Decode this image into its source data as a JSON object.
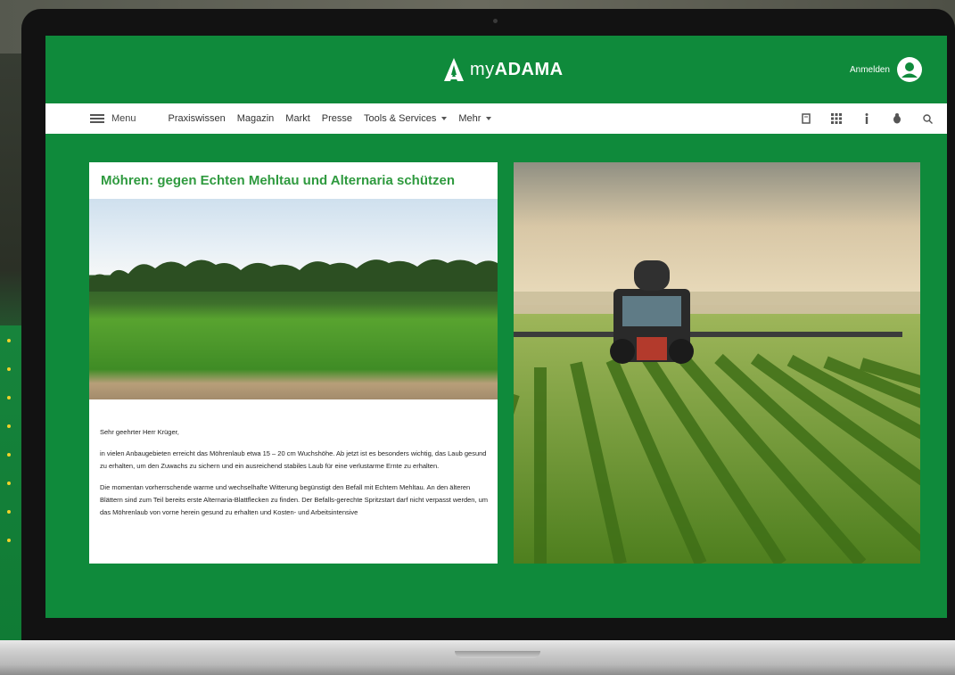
{
  "header": {
    "logo_prefix": "my",
    "logo_brand": "ADAMA",
    "login_label": "Anmelden"
  },
  "nav": {
    "menu_label": "Menu",
    "links": [
      "Praxiswissen",
      "Magazin",
      "Markt",
      "Presse",
      "Tools & Services",
      "Mehr"
    ],
    "icons": [
      "document-icon",
      "grid-icon",
      "info-icon",
      "bug-icon",
      "search-icon"
    ]
  },
  "article": {
    "title": "Möhren: gegen Echten Mehltau und Alternaria schützen",
    "greeting": "Sehr geehrter Herr Krüger,",
    "paragraph1": "in vielen Anbaugebieten erreicht das Möhrenlaub etwa 15 – 20 cm Wuchshöhe. Ab jetzt ist es besonders wichtig, das Laub gesund zu erhalten, um den Zuwachs zu sichern und ein ausreichend stabiles Laub für eine verlustarme Ernte zu erhalten.",
    "paragraph2": "Die momentan vorherrschende warme und wechselhafte Witterung begünstigt den Befall mit Echtem Mehltau. An den älteren Blättern sind zum Teil bereits erste Alternaria-Blattflecken zu finden. Der Befalls-gerechte Spritzstart darf nicht verpasst werden, um das Möhrenlaub von vorne herein gesund zu erhalten und Kosten- und Arbeitsintensive"
  },
  "colors": {
    "brand_green": "#0f8a3b",
    "title_green": "#2f9a3f"
  }
}
